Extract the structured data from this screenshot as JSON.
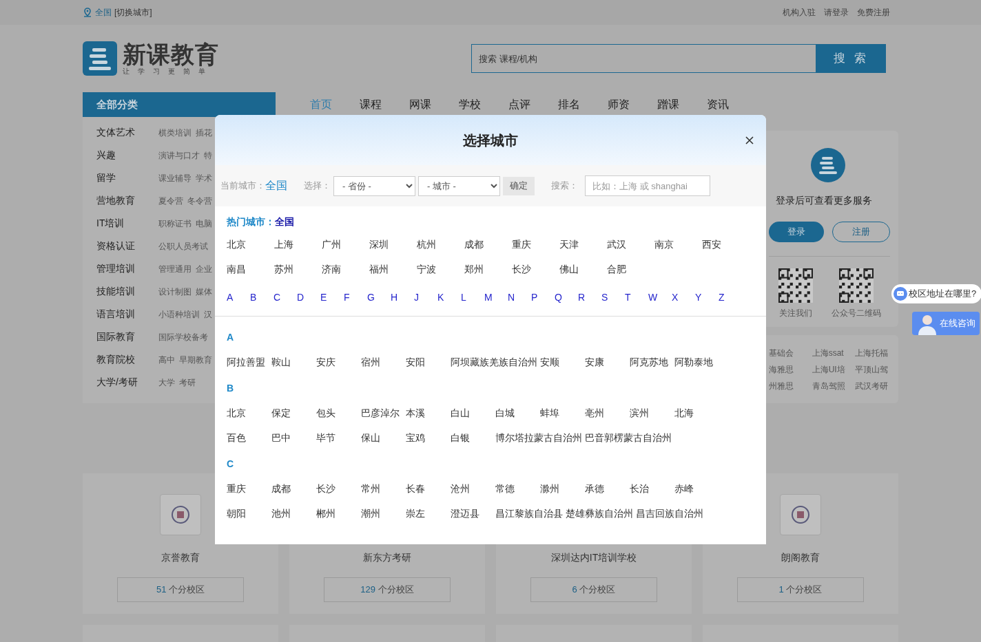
{
  "top_bar": {
    "location": "全国",
    "switch": "[切换城市]",
    "links": [
      "机构入驻",
      "请登录",
      "免费注册"
    ]
  },
  "header": {
    "logo_name": "新课教育",
    "logo_slogan": "让学习更简单",
    "search": {
      "placeholder": "搜索 课程/机构",
      "button": "搜 索"
    }
  },
  "nav": {
    "category_title": "全部分类",
    "items": [
      {
        "label": "首页",
        "selected": true
      },
      {
        "label": "课程",
        "selected": false
      },
      {
        "label": "网课",
        "selected": false
      },
      {
        "label": "学校",
        "selected": false
      },
      {
        "label": "点评",
        "selected": false
      },
      {
        "label": "排名",
        "selected": false
      },
      {
        "label": "师资",
        "selected": false
      },
      {
        "label": "蹭课",
        "selected": false
      },
      {
        "label": "资讯",
        "selected": false
      }
    ]
  },
  "categories": [
    {
      "name": "文体艺术",
      "subs": [
        "棋类培训",
        "插花"
      ]
    },
    {
      "name": "兴趣",
      "subs": [
        "演讲与口才",
        "特"
      ]
    },
    {
      "name": "留学",
      "subs": [
        "课业辅导",
        "学术"
      ]
    },
    {
      "name": "营地教育",
      "subs": [
        "夏令营",
        "冬令营"
      ]
    },
    {
      "name": "IT培训",
      "subs": [
        "职称证书",
        "电脑"
      ]
    },
    {
      "name": "资格认证",
      "subs": [
        "公职人员考试"
      ]
    },
    {
      "name": "管理培训",
      "subs": [
        "管理通用",
        "企业"
      ]
    },
    {
      "name": "技能培训",
      "subs": [
        "设计制图",
        "媒体"
      ]
    },
    {
      "name": "语言培训",
      "subs": [
        "小语种培训",
        "汉"
      ]
    },
    {
      "name": "国际教育",
      "subs": [
        "国际学校备考"
      ]
    },
    {
      "name": "教育院校",
      "subs": [
        "高中",
        "早期教育"
      ]
    },
    {
      "name": "大学/考研",
      "subs": [
        "大学",
        "考研"
      ]
    }
  ],
  "user_panel": {
    "prompt": "登录后可查看更多服务",
    "login": "登录",
    "register": "注册",
    "qr_codes": [
      "关注我们",
      "公众号二维码"
    ]
  },
  "hot_links": [
    "基础会",
    "上海ssat",
    "上海托福",
    "海雅思",
    "上海UI培",
    "平顶山驾",
    "州雅思",
    "青岛驾照",
    "武汉考研"
  ],
  "float": {
    "question": "校区地址在哪里?",
    "consult": "在线咨询"
  },
  "institutions": [
    {
      "name": "京誉教育",
      "count": "51",
      "unit": "个分校区"
    },
    {
      "name": "新东方考研",
      "count": "129",
      "unit": "个分校区"
    },
    {
      "name": "深圳达内IT培训学校",
      "count": "6",
      "unit": "个分校区"
    },
    {
      "name": "朗阁教育",
      "count": "1",
      "unit": "个分校区"
    }
  ],
  "modal": {
    "title": "选择城市",
    "current_label": "当前城市：",
    "current": "全国",
    "select_label": "选择：",
    "province": "- 省份 -",
    "city": "- 城市 -",
    "confirm": "确定",
    "search_label": "搜索：",
    "search_placeholder": "比如：上海 或 shanghai",
    "hot_label": "热门城市：",
    "hot_current": "全国",
    "hot_cities": [
      "北京",
      "上海",
      "广州",
      "深圳",
      "杭州",
      "成都",
      "重庆",
      "天津",
      "武汉",
      "南京",
      "西安",
      "南昌",
      "苏州",
      "济南",
      "福州",
      "宁波",
      "郑州",
      "长沙",
      "佛山",
      "合肥"
    ],
    "letters": [
      "A",
      "B",
      "C",
      "D",
      "E",
      "F",
      "G",
      "H",
      "J",
      "K",
      "L",
      "M",
      "N",
      "P",
      "Q",
      "R",
      "S",
      "T",
      "W",
      "X",
      "Y",
      "Z"
    ],
    "sections": [
      {
        "letter": "A",
        "cities": [
          "阿拉善盟",
          "鞍山",
          "安庆",
          "宿州",
          "安阳",
          "阿坝藏族羌族自治州",
          "安顺",
          "安康",
          "阿克苏地",
          "阿勒泰地"
        ]
      },
      {
        "letter": "B",
        "cities": [
          "北京",
          "保定",
          "包头",
          "巴彦淖尔",
          "本溪",
          "白山",
          "白城",
          "蚌埠",
          "亳州",
          "滨州",
          "北海",
          "百色",
          "巴中",
          "毕节",
          "保山",
          "宝鸡",
          "白银",
          "博尔塔拉蒙古自治州",
          "巴音郭楞蒙古自治州"
        ]
      },
      {
        "letter": "C",
        "cities": [
          "重庆",
          "成都",
          "长沙",
          "常州",
          "长春",
          "沧州",
          "常德",
          "滁州",
          "承德",
          "长治",
          "赤峰",
          "朝阳",
          "池州",
          "郴州",
          "潮州",
          "崇左",
          "澄迈县",
          "昌江黎族自治县",
          "楚雄彝族自治州",
          "昌吉回族自治州"
        ]
      }
    ]
  }
}
